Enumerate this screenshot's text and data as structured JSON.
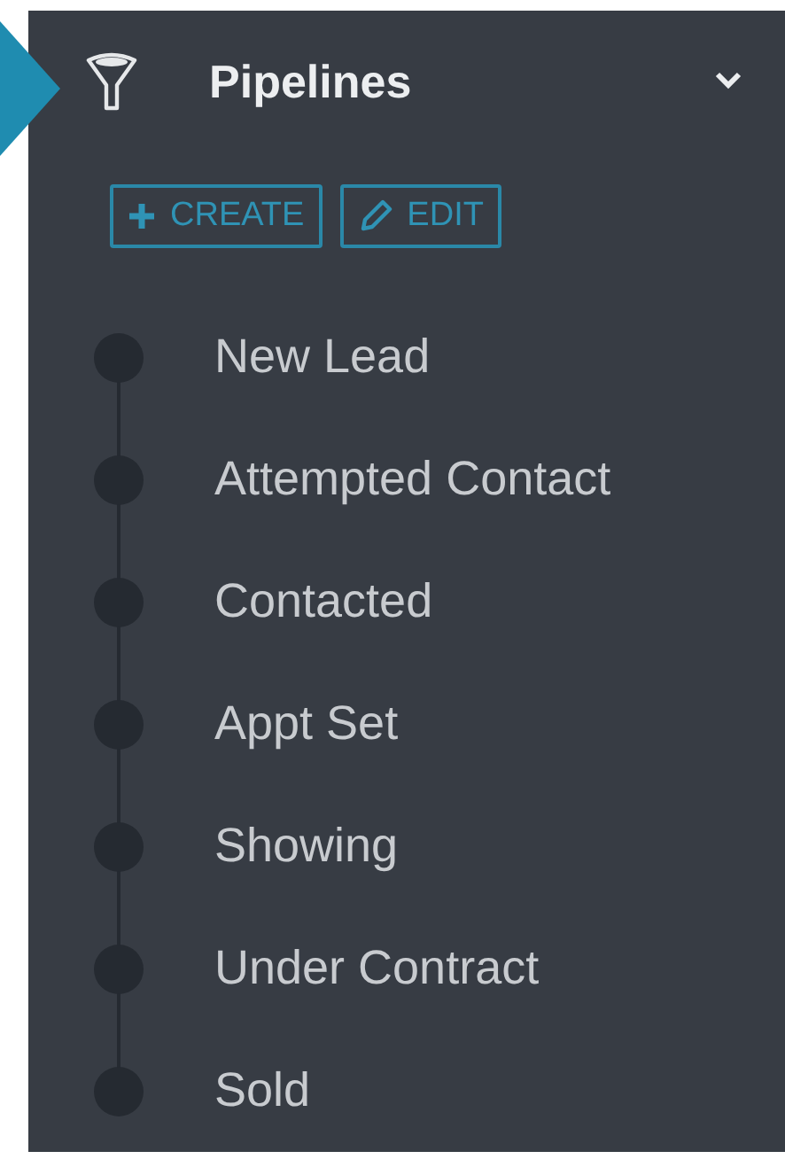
{
  "section": {
    "title": "Pipelines",
    "active": true,
    "expanded": true
  },
  "buttons": [
    {
      "kind": "create",
      "label": "CREATE"
    },
    {
      "kind": "edit",
      "label": "EDIT"
    }
  ],
  "stages": [
    {
      "label": "New Lead"
    },
    {
      "label": "Attempted Contact"
    },
    {
      "label": "Contacted"
    },
    {
      "label": "Appt Set"
    },
    {
      "label": "Showing"
    },
    {
      "label": "Under Contract"
    },
    {
      "label": "Sold"
    }
  ]
}
